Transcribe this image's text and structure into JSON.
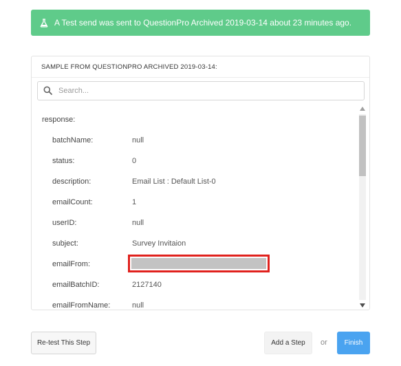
{
  "banner": {
    "message": "A Test send was sent to QuestionPro Archived 2019-03-14 about 23 minutes ago.",
    "icon": "flask-icon",
    "color": "#5fcb8a"
  },
  "panel": {
    "title": "SAMPLE FROM QUESTIONPRO ARCHIVED 2019-03-14:",
    "search_placeholder": "Search...",
    "root_key": "response:",
    "fields": [
      {
        "key": "batchName:",
        "value": "null"
      },
      {
        "key": "status:",
        "value": "0"
      },
      {
        "key": "description:",
        "value": "Email List : Default List-0"
      },
      {
        "key": "emailCount:",
        "value": "1"
      },
      {
        "key": "userID:",
        "value": "null"
      },
      {
        "key": "subject:",
        "value": "Survey Invitaion"
      },
      {
        "key": "emailFrom:",
        "value": ""
      },
      {
        "key": "emailBatchID:",
        "value": "2127140"
      },
      {
        "key": "emailFromName:",
        "value": "null"
      }
    ],
    "redaction_color": "#e0211d"
  },
  "actions": {
    "retest_label": "Re-test This Step",
    "add_step_label": "Add a Step",
    "or_label": "or",
    "finish_label": "Finish",
    "finish_color": "#4aa3f0"
  }
}
